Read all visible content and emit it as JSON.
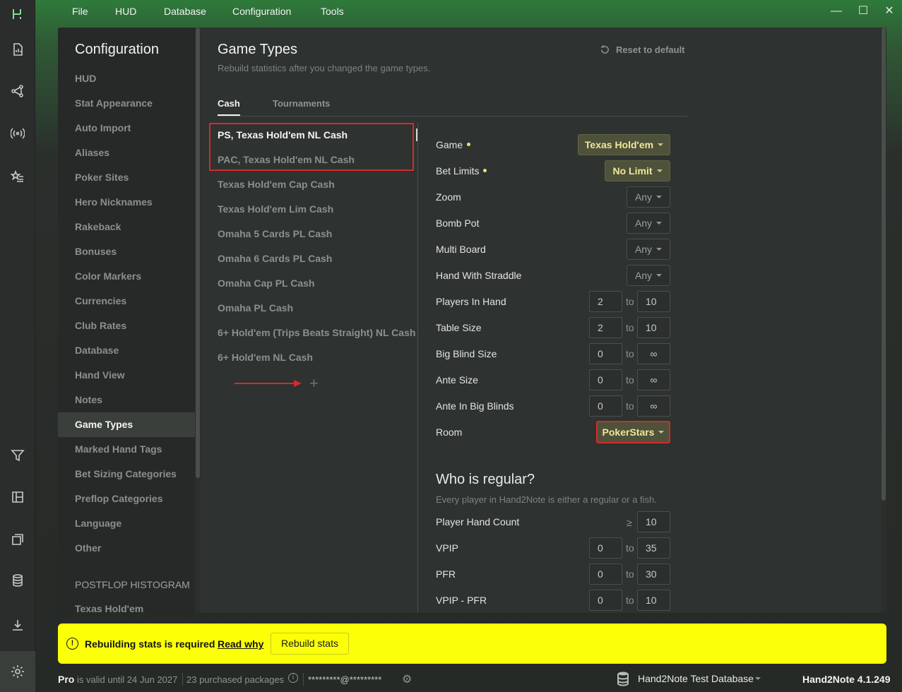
{
  "menu": {
    "items": [
      "File",
      "HUD",
      "Database",
      "Configuration",
      "Tools"
    ]
  },
  "sidebar": {
    "title": "Configuration",
    "items": [
      "HUD",
      "Stat Appearance",
      "Auto Import",
      "Aliases",
      "Poker Sites",
      "Hero Nicknames",
      "Rakeback",
      "Bonuses",
      "Color Markers",
      "Currencies",
      "Club Rates",
      "Database",
      "Hand View",
      "Notes",
      "Game Types",
      "Marked Hand Tags",
      "Bet Sizing Categories",
      "Preflop Categories",
      "Language",
      "Other"
    ],
    "active_item": "Game Types",
    "section_title": "POSTFLOP HISTOGRAM",
    "section_item": "Texas Hold'em"
  },
  "page": {
    "title": "Game Types",
    "subtitle": "Rebuild statistics after you changed the game types.",
    "reset_label": "Reset to default",
    "tabs": [
      "Cash",
      "Tournaments"
    ],
    "active_tab": "Cash"
  },
  "game_types": [
    "PS, Texas Hold'em NL Cash",
    "PAC, Texas Hold'em NL Cash",
    "Texas Hold'em Cap Cash",
    "Texas Hold'em Lim Cash",
    "Omaha 5 Cards PL Cash",
    "Omaha 6 Cards PL Cash",
    "Omaha Cap PL Cash",
    "Omaha PL Cash",
    "6+ Hold'em (Trips Beats Straight) NL Cash",
    "6+ Hold'em NL Cash"
  ],
  "settings": {
    "game": {
      "label": "Game",
      "value": "Texas Hold'em"
    },
    "bet_limits": {
      "label": "Bet Limits",
      "value": "No Limit"
    },
    "zoom": {
      "label": "Zoom",
      "value": "Any"
    },
    "bomb_pot": {
      "label": "Bomb Pot",
      "value": "Any"
    },
    "multi_board": {
      "label": "Multi Board",
      "value": "Any"
    },
    "straddle": {
      "label": "Hand With Straddle",
      "value": "Any"
    },
    "players_in_hand": {
      "label": "Players In Hand",
      "from": "2",
      "to": "10"
    },
    "table_size": {
      "label": "Table Size",
      "from": "2",
      "to": "10"
    },
    "big_blind_size": {
      "label": "Big Blind Size",
      "from": "0",
      "to": "∞"
    },
    "ante_size": {
      "label": "Ante Size",
      "from": "0",
      "to": "∞"
    },
    "ante_in_bb": {
      "label": "Ante In Big Blinds",
      "from": "0",
      "to": "∞"
    },
    "room": {
      "label": "Room",
      "value": "PokerStars"
    },
    "to_word": "to"
  },
  "regular": {
    "title": "Who is regular?",
    "subtitle": "Every player in Hand2Note is either a regular or a fish.",
    "hand_count": {
      "label": "Player Hand Count",
      "op": "≥",
      "value": "10"
    },
    "vpip": {
      "label": "VPIP",
      "from": "0",
      "to": "35"
    },
    "pfr": {
      "label": "PFR",
      "from": "0",
      "to": "30"
    },
    "vpip_pfr": {
      "label": "VPIP - PFR",
      "from": "0",
      "to": "10"
    }
  },
  "banner": {
    "text": "Rebuilding stats is required",
    "link": "Read why",
    "button": "Rebuild stats",
    "color": "#fbff08"
  },
  "status": {
    "plan": "Pro",
    "valid": "is valid until 24 Jun 2027",
    "packages": "23 purchased packages",
    "email": "*********@*********",
    "database": "Hand2Note Test Database",
    "version": "Hand2Note 4.1.249"
  },
  "colors": {
    "accent_green": "#2e7a3a",
    "highlight_text": "#f0e79a",
    "red_mark": "#d62a2a"
  }
}
